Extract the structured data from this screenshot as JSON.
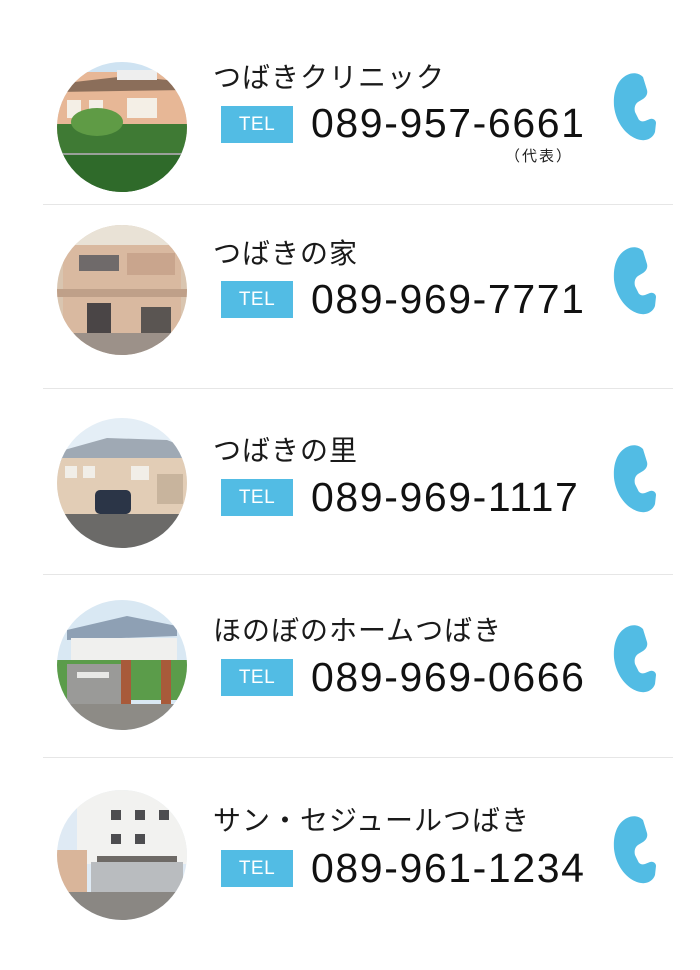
{
  "tel_label": "TEL",
  "accent_color": "#52bce4",
  "call_icon": "phone-handset-icon",
  "facilities": [
    {
      "name": "つばきクリニック",
      "phone": "089-957-6661",
      "note": "（代表）",
      "photo": "clinic-building-photo"
    },
    {
      "name": "つばきの家",
      "phone": "089-969-7771",
      "note": "",
      "photo": "house-building-photo"
    },
    {
      "name": "つばきの里",
      "phone": "089-969-1117",
      "note": "",
      "photo": "village-building-photo"
    },
    {
      "name": "ほのぼのホームつばき",
      "phone": "089-969-0666",
      "note": "",
      "photo": "home-building-photo"
    },
    {
      "name": "サン・セジュールつばき",
      "phone": "089-961-1234",
      "note": "",
      "photo": "sejour-building-photo"
    }
  ]
}
